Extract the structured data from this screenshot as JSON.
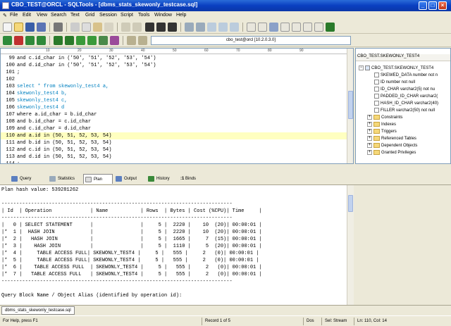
{
  "window": {
    "title": "CBO_TEST@ORCL - SQLTools - [dbms_stats_skewonly_testcase.sql]",
    "min": "_",
    "max": "□",
    "close": "×"
  },
  "menu": [
    "File",
    "Edit",
    "View",
    "Search",
    "Text",
    "Grid",
    "Session",
    "Script",
    "Tools",
    "Window",
    "Help"
  ],
  "connection": "cbo_test@orcl [10.2.0.3.0]",
  "ruler": [
    "10",
    "20",
    "30",
    "40",
    "50",
    "60",
    "70",
    "80",
    "90"
  ],
  "editor_lines": [
    {
      "num": "99",
      "text": "and c.id_char in ('50', '51', '52', '53', '54')"
    },
    {
      "num": "100",
      "text": "and d.id_char in ('50', '51', '52', '53', '54')"
    },
    {
      "num": "101",
      "text": ";"
    },
    {
      "num": "102",
      "text": ""
    },
    {
      "num": "103",
      "text": "select * from skewonly_test4 a,"
    },
    {
      "num": "104",
      "text": "skewonly_test4 b,"
    },
    {
      "num": "105",
      "text": "skewonly_test4 c,"
    },
    {
      "num": "106",
      "text": "skewonly_test4 d"
    },
    {
      "num": "107",
      "text": "where a.id_char = b.id_char"
    },
    {
      "num": "108",
      "text": "and b.id_char = c.id_char"
    },
    {
      "num": "109",
      "text": "and c.id_char = d.id_char"
    },
    {
      "num": "110",
      "text": "and a.id in (50, 51, 52, 53, 54)"
    },
    {
      "num": "111",
      "text": "and b.id in (50, 51, 52, 53, 54)"
    },
    {
      "num": "112",
      "text": "and c.id in (50, 51, 52, 53, 54)"
    },
    {
      "num": "113",
      "text": "and d.id in (50, 51, 52, 53, 54)"
    },
    {
      "num": "114",
      "text": ";"
    }
  ],
  "object_tree": {
    "title": "CBO_TEST.SKEWONLY_TEST4",
    "root": "CBO_TEST.SKEWONLY_TEST4",
    "columns": [
      "SKEWED_DATA  number  not n",
      "ID  number  not null",
      "ID_CHAR  varchar2(5)  not nu",
      "PADDED_ID_CHAR  varchar2(",
      "HASH_ID_CHAR  varchar2(40)",
      "FILLER  varchar2(50)  not null"
    ],
    "folders": [
      "Constraints",
      "Indexes",
      "Triggers",
      "Referenced Tables",
      "Dependent Objects",
      "Granted Privileges"
    ]
  },
  "tabs": [
    "Query",
    "Statistics",
    "Plan",
    "Output",
    "History",
    "Binds"
  ],
  "binds_prefix": ":1",
  "output_lines": [
    "Plan hash value: 539281262",
    "",
    "------------------------------------------------------------------------------",
    "| Id  | Operation             | Name           | Rows  | Bytes | Cost (%CPU)| Time     |",
    "------------------------------------------------------------------------------",
    "|   0 | SELECT STATEMENT      |                |     5 |  2220 |    10  (20)| 00:00:01 |",
    "|*  1 |  HASH JOIN            |                |     5 |  2220 |    10  (20)| 00:00:01 |",
    "|*  2 |   HASH JOIN           |                |     5 |  1665 |     7  (15)| 00:00:01 |",
    "|*  3 |    HASH JOIN          |                |     5 |  1110 |     5  (20)| 00:00:01 |",
    "|*  4 |     TABLE ACCESS FULL| SKEWONLY_TEST4 |     5 |   555 |     2   (0)| 00:00:01 |",
    "|*  5 |     TABLE ACCESS FULL| SKEWONLY_TEST4 |     5 |   555 |     2   (0)| 00:00:01 |",
    "|*  6 |    TABLE ACCESS FULL  | SKEWONLY_TEST4 |     5 |   555 |     2   (0)| 00:00:01 |",
    "|*  7 |   TABLE ACCESS FULL   | SKEWONLY_TEST4 |     5 |   555 |     2   (0)| 00:00:01 |",
    "------------------------------------------------------------------------------",
    "",
    "Query Block Name / Object Alias (identified by operation id):"
  ],
  "doc_tab": "dbms_stats_skewonly_testcase.sql",
  "status": {
    "help": "For Help, press F1",
    "record": "Record 1 of 5",
    "format": "Dos",
    "session": "Sel: Stream",
    "position": "Ln: 110, Col: 14"
  }
}
